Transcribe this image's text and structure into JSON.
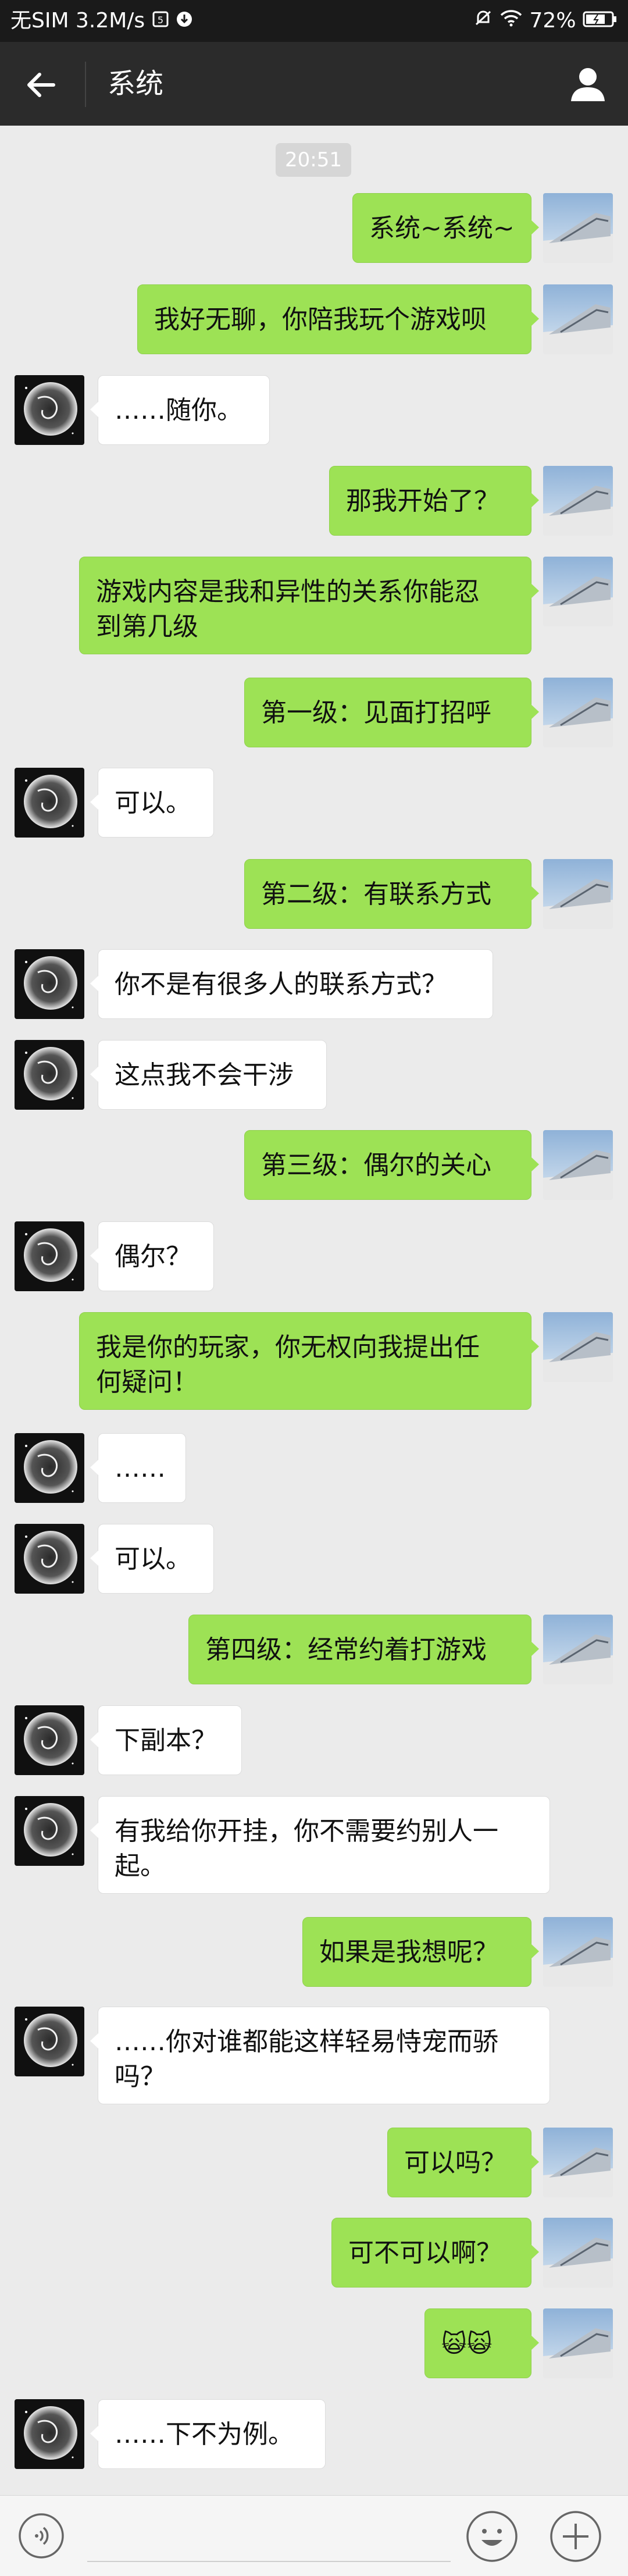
{
  "status_bar": {
    "carrier": "无SIM",
    "speed": "3.2M/s",
    "battery": "72%"
  },
  "header": {
    "title": "系统"
  },
  "timestamp": "20:51",
  "messages": [
    {
      "side": "me",
      "text": "系统~系统~"
    },
    {
      "side": "me",
      "text": "我好无聊，你陪我玩个游戏呗"
    },
    {
      "side": "other",
      "text": "……随你。"
    },
    {
      "side": "me",
      "text": "那我开始了？"
    },
    {
      "side": "me",
      "text": "游戏内容是我和异性的关系你能忍\n到第几级"
    },
    {
      "side": "me",
      "text": "第一级：见面打招呼"
    },
    {
      "side": "other",
      "text": "可以。"
    },
    {
      "side": "me",
      "text": "第二级：有联系方式"
    },
    {
      "side": "other",
      "text": "你不是有很多人的联系方式？"
    },
    {
      "side": "other",
      "text": "这点我不会干涉"
    },
    {
      "side": "me",
      "text": "第三级：偶尔的关心"
    },
    {
      "side": "other",
      "text": "偶尔？"
    },
    {
      "side": "me",
      "text": "我是你的玩家，你无权向我提出任\n何疑问！"
    },
    {
      "side": "other",
      "text": "……"
    },
    {
      "side": "other",
      "text": "可以。"
    },
    {
      "side": "me",
      "text": "第四级：经常约着打游戏"
    },
    {
      "side": "other",
      "text": "下副本？"
    },
    {
      "side": "other",
      "text": "有我给你开挂，你不需要约别人一\n起。"
    },
    {
      "side": "me",
      "text": "如果是我想呢？"
    },
    {
      "side": "other",
      "text": "……你对谁都能这样轻易恃宠而骄\n吗？"
    },
    {
      "side": "me",
      "text": "可以吗？"
    },
    {
      "side": "me",
      "text": "可不可以啊？"
    },
    {
      "side": "me",
      "text": "🙀🙀"
    },
    {
      "side": "other",
      "text": "……下不为例。"
    }
  ]
}
